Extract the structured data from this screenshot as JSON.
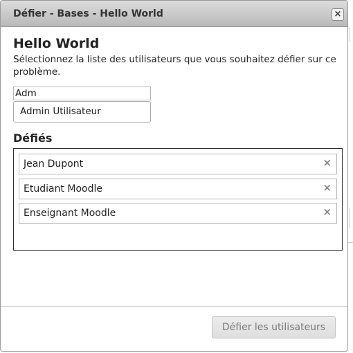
{
  "dialog": {
    "title": "Défier - Bases - Hello World",
    "close_glyph": "×"
  },
  "main": {
    "heading": "Hello World",
    "description": "Sélectionnez la liste des utilisateurs que vous souhaitez défier sur ce problème."
  },
  "search": {
    "value": "Adm",
    "suggestion": "Admin Utilisateur"
  },
  "challenged": {
    "label": "Défiés",
    "remove_glyph": "×",
    "users": [
      {
        "name": "Jean Dupont"
      },
      {
        "name": "Etudiant Moodle"
      },
      {
        "name": "Enseignant Moodle"
      }
    ]
  },
  "footer": {
    "submit_label": "Défier les utilisateurs"
  },
  "icons": {
    "close": "close-icon",
    "remove": "remove-icon"
  }
}
